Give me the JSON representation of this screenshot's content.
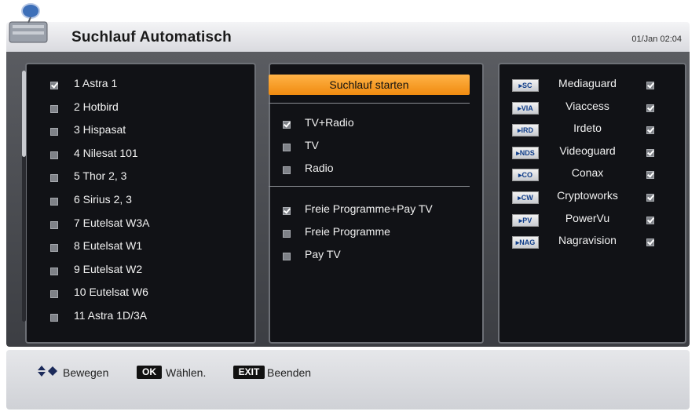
{
  "header": {
    "title": "Suchlauf Automatisch",
    "clock": "01/Jan 02:04"
  },
  "satellites": [
    {
      "label": "1 Astra 1",
      "checked": true
    },
    {
      "label": "2 Hotbird",
      "checked": false
    },
    {
      "label": "3 Hispasat",
      "checked": false
    },
    {
      "label": "4 Nilesat 101",
      "checked": false
    },
    {
      "label": "5 Thor 2, 3",
      "checked": false
    },
    {
      "label": "6 Sirius 2, 3",
      "checked": false
    },
    {
      "label": "7 Eutelsat W3A",
      "checked": false
    },
    {
      "label": "8 Eutelsat W1",
      "checked": false
    },
    {
      "label": "9 Eutelsat W2",
      "checked": false
    },
    {
      "label": "10 Eutelsat W6",
      "checked": false
    },
    {
      "label": "11 Astra 1D/3A",
      "checked": false
    }
  ],
  "scan": {
    "start_label": "Suchlauf starten",
    "service_types": [
      {
        "label": "TV+Radio",
        "checked": true
      },
      {
        "label": "TV",
        "checked": false
      },
      {
        "label": "Radio",
        "checked": false
      }
    ],
    "program_types": [
      {
        "label": "Freie Programme+Pay TV",
        "checked": true
      },
      {
        "label": "Freie Programme",
        "checked": false
      },
      {
        "label": "Pay TV",
        "checked": false
      }
    ]
  },
  "cas_systems": [
    {
      "badge": "SC",
      "name": "Mediaguard",
      "checked": true
    },
    {
      "badge": "VIA",
      "name": "Viaccess",
      "checked": true
    },
    {
      "badge": "IRD",
      "name": "Irdeto",
      "checked": true
    },
    {
      "badge": "NDS",
      "name": "Videoguard",
      "checked": true
    },
    {
      "badge": "CO",
      "name": "Conax",
      "checked": true
    },
    {
      "badge": "CW",
      "name": "Cryptoworks",
      "checked": true
    },
    {
      "badge": "PV",
      "name": "PowerVu",
      "checked": true
    },
    {
      "badge": "NAG",
      "name": "Nagravision",
      "checked": true
    }
  ],
  "footer": {
    "move_label": "Bewegen",
    "ok_key": "OK",
    "select_label": "Wählen.",
    "exit_key": "EXIT",
    "exit_label": "Beenden"
  },
  "colors": {
    "accent": "#f5981f",
    "panel": "#111216",
    "frame": "#4b4d52"
  }
}
